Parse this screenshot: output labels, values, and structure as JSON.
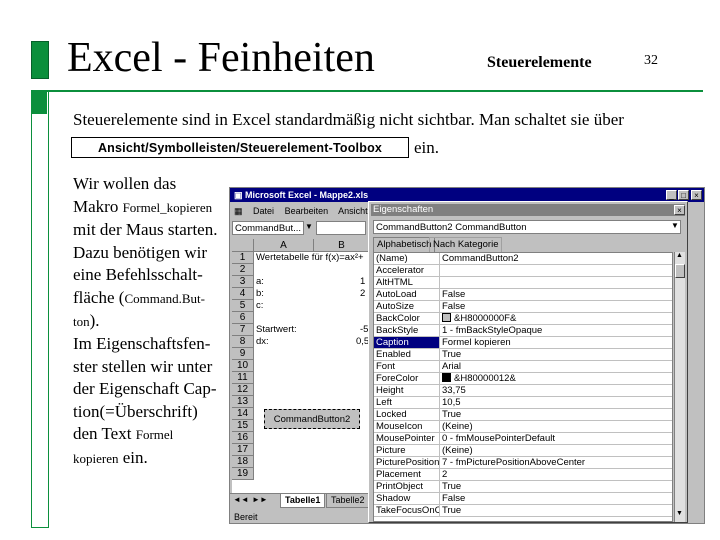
{
  "slide": {
    "title": "Excel - Feinheiten",
    "subtitle": "Steuerelemente",
    "page": "32",
    "intro": "Steuerelemente sind in Excel standardmäßig nicht sichtbar. Man schaltet sie über",
    "path": "Ansicht/Symbolleisten/Steuerelement-Toolbox",
    "ein": "ein.",
    "para1": [
      "Wir wollen das",
      "Makro ",
      "Formel_kopieren",
      "mit der Maus starten.",
      "Dazu benötigen wir",
      "eine Befehlsschalt-",
      "fläche (",
      "Command.But-",
      "ton",
      ")."
    ],
    "para2": [
      "Im Eigenschaftsfen-",
      "ster stellen wir unter",
      "der Eigenschaft Cap-",
      "tion(=Überschrift)",
      "den Text ",
      "Formel",
      "kopieren",
      " ein."
    ]
  },
  "excel": {
    "title": "Microsoft Excel - Mappe2.xls",
    "menu": [
      "Datei",
      "Bearbeiten",
      "Ansicht",
      "E"
    ],
    "namebox": "CommandBut...",
    "columns": [
      "A",
      "B"
    ],
    "rows": [
      "1",
      "2",
      "3",
      "4",
      "5",
      "6",
      "7",
      "8",
      "9",
      "10",
      "11",
      "12",
      "13",
      "14",
      "15",
      "16",
      "17",
      "18",
      "19"
    ],
    "cells": {
      "a1": "Wertetabelle für f(x)=ax²+",
      "a3": "a:",
      "a4": "b:",
      "a5": "c:",
      "b3": "1",
      "b4": "2",
      "a7": "Startwert:",
      "a8": "dx:",
      "b7": "-5",
      "b8": "0,5"
    },
    "command_button": "CommandButton2",
    "sheet_tabs": [
      "Tabelle1",
      "Tabelle2"
    ],
    "status": "Bereit"
  },
  "props": {
    "title": "Eigenschaften",
    "object": "CommandButton2 CommandButton",
    "tabs": [
      "Alphabetisch",
      "Nach Kategorie"
    ],
    "rows": [
      {
        "name": "(Name)",
        "value": "CommandButton2"
      },
      {
        "name": "Accelerator",
        "value": ""
      },
      {
        "name": "AltHTML",
        "value": ""
      },
      {
        "name": "AutoLoad",
        "value": "False"
      },
      {
        "name": "AutoSize",
        "value": "False"
      },
      {
        "name": "BackColor",
        "value": "&H8000000F&",
        "swatch": "#c0c0c0"
      },
      {
        "name": "BackStyle",
        "value": "1 - fmBackStyleOpaque"
      },
      {
        "name": "Caption",
        "value": "Formel kopieren",
        "selected": true
      },
      {
        "name": "Enabled",
        "value": "True"
      },
      {
        "name": "Font",
        "value": "Arial"
      },
      {
        "name": "ForeColor",
        "value": "&H80000012&",
        "swatch": "#000000"
      },
      {
        "name": "Height",
        "value": "33,75"
      },
      {
        "name": "Left",
        "value": "10,5"
      },
      {
        "name": "Locked",
        "value": "True"
      },
      {
        "name": "MouseIcon",
        "value": "(Keine)"
      },
      {
        "name": "MousePointer",
        "value": "0 - fmMousePointerDefault"
      },
      {
        "name": "Picture",
        "value": "(Keine)"
      },
      {
        "name": "PicturePosition",
        "value": "7 - fmPicturePositionAboveCenter"
      },
      {
        "name": "Placement",
        "value": "2"
      },
      {
        "name": "PrintObject",
        "value": "True"
      },
      {
        "name": "Shadow",
        "value": "False"
      },
      {
        "name": "TakeFocusOnClick",
        "value": "True"
      }
    ]
  },
  "colors": {
    "accent": "#0b8f3c",
    "titlebar": "#000080"
  }
}
